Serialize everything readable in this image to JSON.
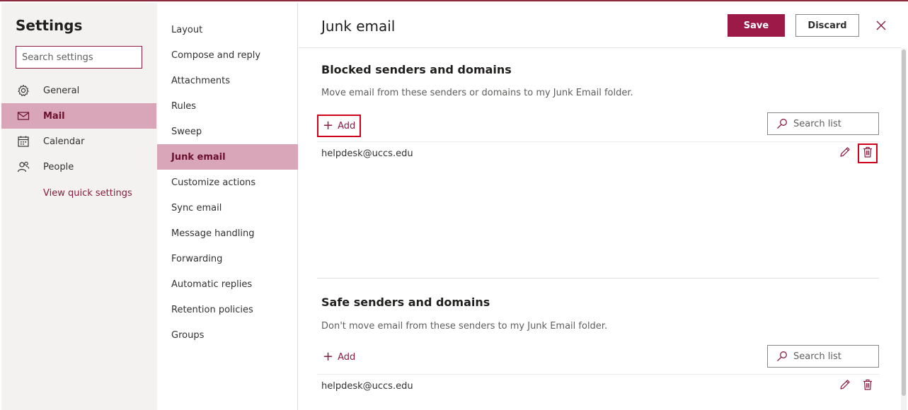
{
  "left": {
    "title": "Settings",
    "search_placeholder": "Search settings",
    "items": [
      {
        "label": "General",
        "icon": "gear-icon"
      },
      {
        "label": "Mail",
        "icon": "mail-icon"
      },
      {
        "label": "Calendar",
        "icon": "calendar-icon"
      },
      {
        "label": "People",
        "icon": "people-icon"
      }
    ],
    "quick_link": "View quick settings"
  },
  "middle": {
    "items": [
      {
        "label": "Layout"
      },
      {
        "label": "Compose and reply"
      },
      {
        "label": "Attachments"
      },
      {
        "label": "Rules"
      },
      {
        "label": "Sweep"
      },
      {
        "label": "Junk email"
      },
      {
        "label": "Customize actions"
      },
      {
        "label": "Sync email"
      },
      {
        "label": "Message handling"
      },
      {
        "label": "Forwarding"
      },
      {
        "label": "Automatic replies"
      },
      {
        "label": "Retention policies"
      },
      {
        "label": "Groups"
      }
    ]
  },
  "right": {
    "title": "Junk email",
    "save_label": "Save",
    "discard_label": "Discard",
    "blocked": {
      "title": "Blocked senders and domains",
      "description": "Move email from these senders or domains to my Junk Email folder.",
      "add_label": "Add",
      "search_label": "Search list",
      "entries": [
        "helpdesk@uccs.edu"
      ]
    },
    "safe": {
      "title": "Safe senders and domains",
      "description": "Don't move email from these senders to my Junk Email folder.",
      "add_label": "Add",
      "search_label": "Search list",
      "entries": [
        "helpdesk@uccs.edu"
      ]
    }
  },
  "colors": {
    "accent": "#9b1a48",
    "selected_bg": "#d8a6b8",
    "highlight_box": "#d0021b"
  }
}
